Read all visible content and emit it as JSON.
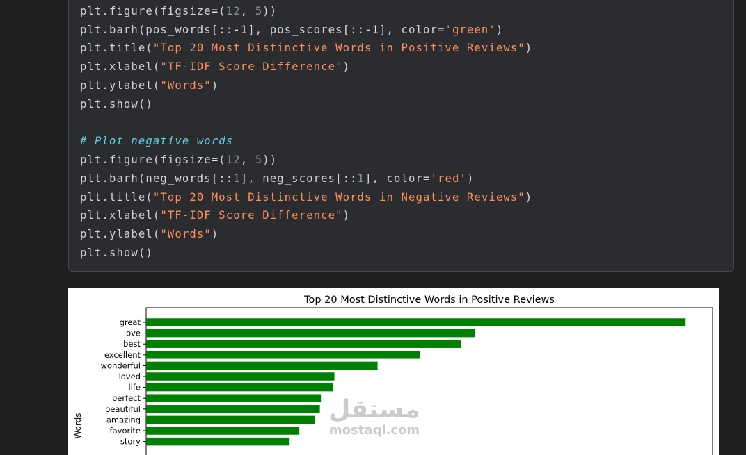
{
  "code": {
    "lines": [
      {
        "y": 5,
        "tokens": [
          [
            "plt.figure(figsize",
            "t"
          ],
          [
            "=",
            "o"
          ],
          [
            "(",
            "t"
          ],
          [
            "12",
            "n"
          ],
          [
            ", ",
            "t"
          ],
          [
            "5",
            "n"
          ],
          [
            "))",
            "t"
          ]
        ]
      },
      {
        "y": 32,
        "tokens": [
          [
            "plt.barh(pos_words[::",
            "t"
          ],
          [
            "-1",
            "o"
          ],
          [
            "], pos_scores[::",
            "t"
          ],
          [
            "-1",
            "o"
          ],
          [
            "], color=",
            "t"
          ],
          [
            "'green'",
            "s"
          ],
          [
            ")",
            "t"
          ]
        ]
      },
      {
        "y": 58,
        "tokens": [
          [
            "plt.title(",
            "t"
          ],
          [
            "\"Top 20 Most Distinctive Words in Positive Reviews\"",
            "s"
          ],
          [
            ")",
            "t"
          ]
        ]
      },
      {
        "y": 85,
        "tokens": [
          [
            "plt.xlabel(",
            "t"
          ],
          [
            "\"TF-IDF Score Difference\"",
            "s"
          ],
          [
            ")",
            "t"
          ]
        ]
      },
      {
        "y": 112,
        "tokens": [
          [
            "plt.ylabel(",
            "t"
          ],
          [
            "\"Words\"",
            "s"
          ],
          [
            ")",
            "t"
          ]
        ]
      },
      {
        "y": 139,
        "tokens": [
          [
            "plt.show()",
            "t"
          ]
        ]
      },
      {
        "y": 192,
        "tokens": [
          [
            "# Plot negative words",
            "c"
          ]
        ]
      },
      {
        "y": 219,
        "tokens": [
          [
            "plt.figure(figsize",
            "t"
          ],
          [
            "=",
            "o"
          ],
          [
            "(",
            "t"
          ],
          [
            "12",
            "n"
          ],
          [
            ", ",
            "t"
          ],
          [
            "5",
            "n"
          ],
          [
            "))",
            "t"
          ]
        ]
      },
      {
        "y": 246,
        "tokens": [
          [
            "plt.barh(neg_words[::",
            "t"
          ],
          [
            "1",
            "n"
          ],
          [
            "], neg_scores[::",
            "t"
          ],
          [
            "1",
            "n"
          ],
          [
            "], color=",
            "t"
          ],
          [
            "'red'",
            "s"
          ],
          [
            ")",
            "t"
          ]
        ]
      },
      {
        "y": 273,
        "tokens": [
          [
            "plt.title(",
            "t"
          ],
          [
            "\"Top 20 Most Distinctive Words in Negative Reviews\"",
            "s"
          ],
          [
            ")",
            "t"
          ]
        ]
      },
      {
        "y": 299,
        "tokens": [
          [
            "plt.xlabel(",
            "t"
          ],
          [
            "\"TF-IDF Score Difference\"",
            "s"
          ],
          [
            ")",
            "t"
          ]
        ]
      },
      {
        "y": 326,
        "tokens": [
          [
            "plt.ylabel(",
            "t"
          ],
          [
            "\"Words\"",
            "s"
          ],
          [
            ")",
            "t"
          ]
        ]
      },
      {
        "y": 353,
        "tokens": [
          [
            "plt.show()",
            "t"
          ]
        ]
      }
    ]
  },
  "chart_data": {
    "type": "bar",
    "orientation": "horizontal",
    "title": "Top 20 Most Distinctive Words in Positive Reviews",
    "xlabel": "TF-IDF Score Difference",
    "ylabel": "Words",
    "bar_color": "#008000",
    "categories": [
      "great",
      "love",
      "best",
      "excellent",
      "wonderful",
      "loved",
      "life",
      "perfect",
      "beautiful",
      "amazing",
      "favorite",
      "story"
    ],
    "values": [
      1.0,
      0.609,
      0.583,
      0.507,
      0.429,
      0.349,
      0.346,
      0.324,
      0.322,
      0.313,
      0.284,
      0.266
    ],
    "xlim": [
      0,
      1.05
    ]
  },
  "watermark": {
    "arabic": "مستقل",
    "latin": "mostaql.com"
  },
  "colors": {
    "background": "#1e1f21",
    "cell_background": "#2b2c2f",
    "string": "#ff8f5a",
    "comment": "#5fd0e0",
    "number": "#8f9299"
  }
}
